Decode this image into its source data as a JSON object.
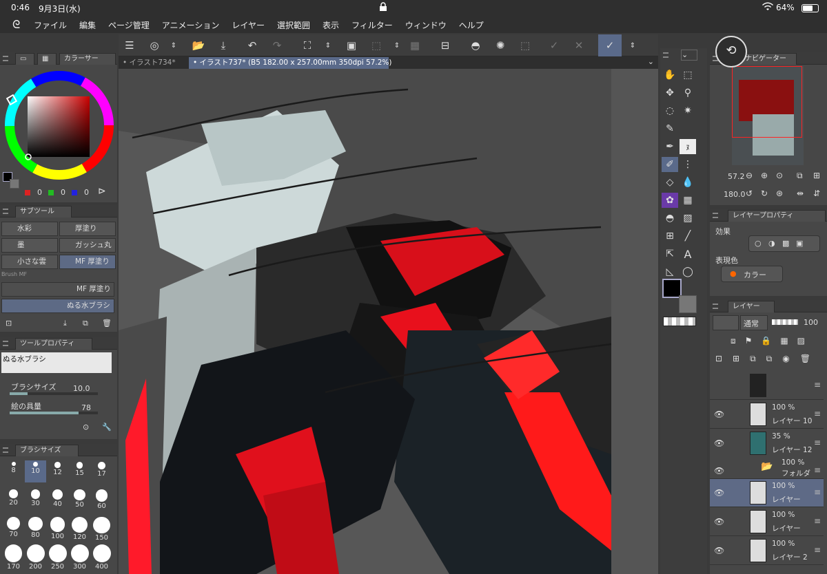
{
  "status": {
    "time": "0:46",
    "date": "9月3日(水)",
    "battery": "64%"
  },
  "menu": [
    "ファイル",
    "編集",
    "ページ管理",
    "アニメーション",
    "レイヤー",
    "選択範囲",
    "表示",
    "フィルター",
    "ウィンドウ",
    "ヘルプ"
  ],
  "tabs": [
    {
      "label": "• イラスト734*"
    },
    {
      "label": "• イラスト737* (B5 182.00 x 257.00mm 350dpi 57.2%)"
    }
  ],
  "color_panel": {
    "tab_label": "カラーサー",
    "r": "0",
    "g": "0",
    "b": "0"
  },
  "subtool_panel": {
    "tab_label": "サブツール",
    "tools": [
      "水彩",
      "厚塗り",
      "墨",
      "ガッシュ丸",
      "小さな雲",
      "MF 厚塗り"
    ],
    "brushes": [
      "MF 厚塗り",
      "ぬる水ブラシ"
    ],
    "partial_label": "Brush MF"
  },
  "tool_property": {
    "tab_label": "ツールプロパティ",
    "brush_name": "ぬる水ブラシ",
    "brush_size_label": "ブラシサイズ",
    "brush_size_value": "10.0",
    "paint_amount_label": "絵の具量",
    "paint_amount_value": "78"
  },
  "brush_size_panel": {
    "tab_label": "ブラシサイズ",
    "sizes": [
      "8",
      "10",
      "12",
      "15",
      "17",
      "20",
      "30",
      "40",
      "50",
      "60",
      "70",
      "80",
      "100",
      "120",
      "150",
      "170",
      "200",
      "250",
      "300",
      "400"
    ]
  },
  "navigator": {
    "tab_label": "ナビゲーター",
    "zoom": "57.2",
    "rotation": "180.0"
  },
  "layer_property": {
    "tab_label": "レイヤープロパティ",
    "effect_label": "効果",
    "expression_label": "表現色",
    "expression_value": "カラー"
  },
  "layers_panel": {
    "tab_label": "レイヤー",
    "blend_mode": "通常",
    "opacity": "100",
    "layers": [
      {
        "pct": "",
        "name": ""
      },
      {
        "pct": "100 %",
        "name": "レイヤー 10"
      },
      {
        "pct": "35 %",
        "name": "レイヤー 12"
      },
      {
        "pct": "100 %",
        "name": "フォルダ"
      },
      {
        "pct": "100 %",
        "name": "レイヤー"
      },
      {
        "pct": "100 %",
        "name": "レイヤー"
      },
      {
        "pct": "100 %",
        "name": "レイヤー 2"
      }
    ]
  },
  "icons": {
    "accent": "#5d6a85",
    "red": "#ff1a1a"
  }
}
